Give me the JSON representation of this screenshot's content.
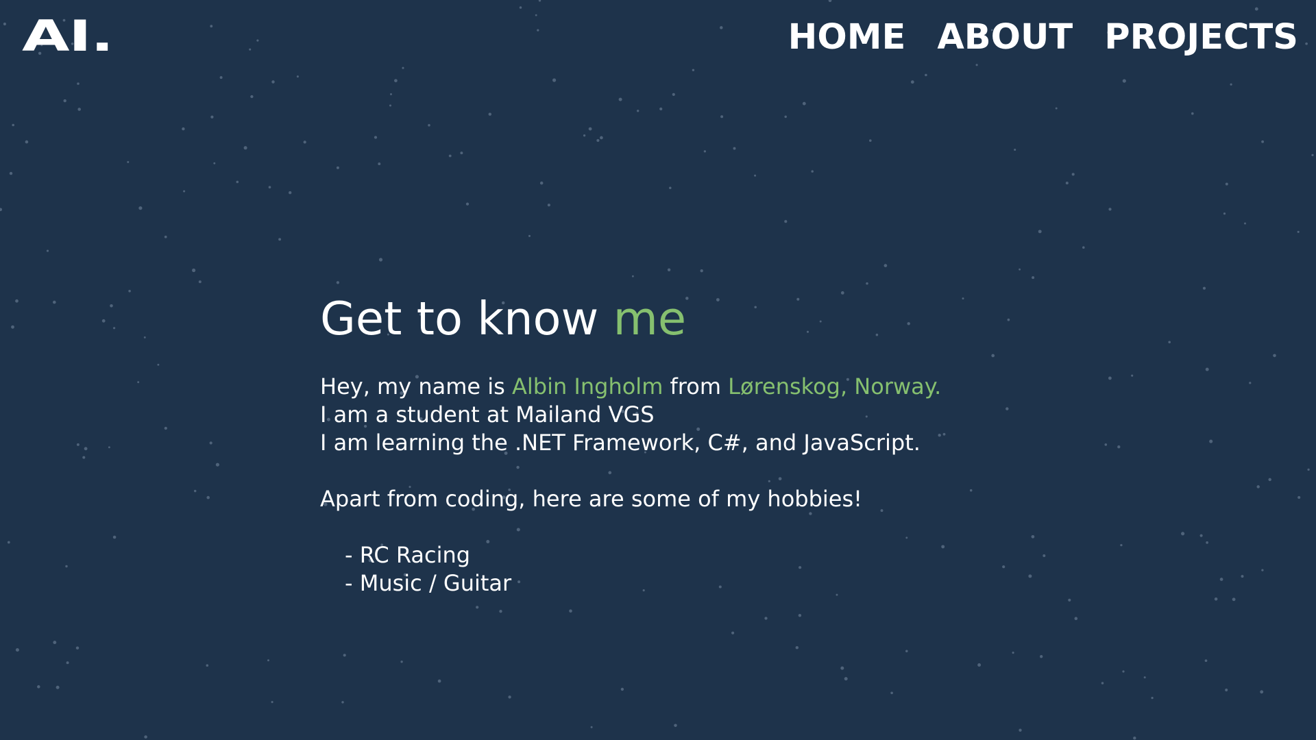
{
  "brand": {
    "logo_text": "AI."
  },
  "nav": {
    "items": [
      {
        "label": "HOME"
      },
      {
        "label": "ABOUT"
      },
      {
        "label": "PROJECTS"
      }
    ]
  },
  "about": {
    "heading_main": "Get to know ",
    "heading_accent": "me",
    "intro_prefix": "Hey, my name is ",
    "name": "Albin Ingholm",
    "intro_from": " from ",
    "location": "Lørenskog, Norway.",
    "line_school": "I am a student at Mailand VGS",
    "line_learning": "I am learning the .NET Framework, C#, and JavaScript.",
    "line_hobbies_intro": "Apart from coding, here are some of my hobbies!",
    "hobbies": [
      "- RC Racing",
      "- Music / Guitar"
    ]
  },
  "colors": {
    "background": "#1e334b",
    "accent": "#86c06f",
    "text": "#ffffff",
    "star": "#4f637a"
  }
}
